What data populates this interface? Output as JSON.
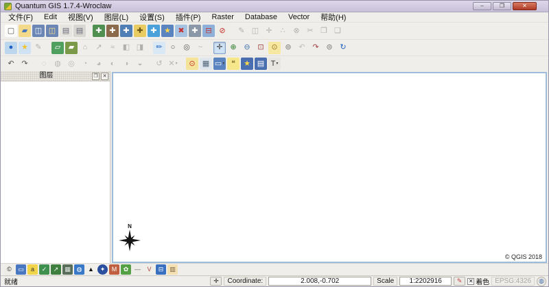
{
  "window": {
    "title": "Quantum GIS 1.7.4-Wroclaw",
    "buttons": [
      {
        "n": "minimize-button",
        "g": "–"
      },
      {
        "n": "restore-button",
        "g": "❐"
      },
      {
        "n": "close-button",
        "g": "✕",
        "cls": "close"
      }
    ]
  },
  "menu": {
    "items": [
      {
        "n": "menu-item-file",
        "g": "文件(F)"
      },
      {
        "n": "menu-item-edit",
        "g": "Edit"
      },
      {
        "n": "menu-item-view",
        "g": "视图(V)"
      },
      {
        "n": "menu-item-layer",
        "g": "图层(L)"
      },
      {
        "n": "menu-item-settings",
        "g": "设置(S)"
      },
      {
        "n": "menu-item-plugins",
        "g": "插件(P)"
      },
      {
        "n": "menu-item-raster",
        "g": "Raster"
      },
      {
        "n": "menu-item-database",
        "g": "Database"
      },
      {
        "n": "menu-item-vector",
        "g": "Vector"
      },
      {
        "n": "menu-item-help",
        "g": "帮助(H)"
      }
    ]
  },
  "toolbars": {
    "row1": [
      {
        "n": "new-project-icon",
        "g": "▢",
        "fg": "#555",
        "bg": "#fdfdfb"
      },
      {
        "n": "open-project-icon",
        "g": "▰",
        "fg": "#4a78b8",
        "bg": "#f3d98a"
      },
      {
        "n": "save-project-icon",
        "g": "◫",
        "fg": "#ffffff",
        "bg": "#6b86b5"
      },
      {
        "n": "save-project-as-icon",
        "g": "◫",
        "fg": "#ffe28a",
        "bg": "#6b86b5"
      },
      {
        "n": "new-print-composer-icon",
        "g": "▤",
        "fg": "#666677",
        "bg": "#e6e4de"
      },
      {
        "n": "composer-manager-icon",
        "g": "▤",
        "fg": "#666677",
        "bg": "#d9d7d1"
      },
      {
        "sep": true
      },
      {
        "n": "add-vector-layer-icon",
        "g": "✚",
        "fg": "#ffffff",
        "bg": "#4f8f4f"
      },
      {
        "n": "add-raster-layer-icon",
        "g": "✚",
        "fg": "#ffffff",
        "bg": "#8a6a4a"
      },
      {
        "n": "add-postgis-layer-icon",
        "g": "✚",
        "fg": "#ffffff",
        "bg": "#4f7fb5"
      },
      {
        "n": "add-spatialite-layer-icon",
        "g": "✚",
        "fg": "#6a5512",
        "bg": "#e8cc62"
      },
      {
        "n": "add-wms-layer-icon",
        "g": "✚",
        "fg": "#ffffff",
        "bg": "#4aa0d8"
      },
      {
        "n": "new-shapefile-layer-icon",
        "g": "★",
        "fg": "#ffd84a",
        "bg": "#5a84c0"
      },
      {
        "n": "remove-layer-icon",
        "g": "✖",
        "fg": "#c62f2f",
        "bg": "#a6c4e2"
      },
      {
        "n": "add-wfs-layer-icon",
        "g": "✚",
        "fg": "#ffffff",
        "bg": "#8a98a8"
      },
      {
        "n": "trash-layer-icon",
        "g": "⊟",
        "fg": "#c62f2f",
        "bg": "#8fb0d8"
      },
      {
        "n": "disable-edit-icon",
        "g": "⊘",
        "fg": "#c62828",
        "bg": "#efede7"
      },
      {
        "sep": true
      },
      {
        "n": "toggle-editing-icon",
        "g": "✎",
        "fg": "#555",
        "d": true
      },
      {
        "n": "save-edits-icon",
        "g": "◫",
        "fg": "#555",
        "d": true
      },
      {
        "n": "move-feature-icon",
        "g": "✛",
        "fg": "#555",
        "d": true
      },
      {
        "n": "node-tool-icon",
        "g": "∴",
        "fg": "#555",
        "d": true
      },
      {
        "n": "delete-selected-icon",
        "g": "⊗",
        "fg": "#555",
        "d": true
      },
      {
        "n": "cut-features-icon",
        "g": "✂",
        "fg": "#555",
        "d": true
      },
      {
        "n": "copy-features-icon",
        "g": "❐",
        "fg": "#555",
        "d": true
      },
      {
        "n": "paste-features-icon",
        "g": "❑",
        "fg": "#555",
        "d": true
      }
    ],
    "row2": [
      {
        "n": "capture-point-icon",
        "g": "●",
        "fg": "#2060c0",
        "bg": "#bcd6ee"
      },
      {
        "n": "star-annotation-icon",
        "g": "★",
        "fg": "#f2c230",
        "bg": "#cfe2f3"
      },
      {
        "n": "gray-annotation-icon",
        "g": "✎",
        "fg": "#555",
        "d": true
      },
      {
        "sep": true
      },
      {
        "n": "capture-line-icon",
        "g": "▱",
        "fg": "#ffffff",
        "bg": "#4f9f5f"
      },
      {
        "n": "capture-polygon-icon",
        "g": "▰",
        "fg": "#ffffff",
        "bg": "#7a9a4a"
      },
      {
        "n": "move-vertex-icon",
        "g": "⌂",
        "fg": "#555",
        "d": true
      },
      {
        "n": "rotate-feature-icon",
        "g": "↗",
        "fg": "#555",
        "d": true
      },
      {
        "n": "offset-curve-icon",
        "g": "≈",
        "fg": "#555",
        "d": true
      },
      {
        "n": "overview-panel-icon",
        "g": "◧",
        "fg": "#555",
        "d": true
      },
      {
        "n": "legend-panel-icon",
        "g": "◨",
        "fg": "#555",
        "d": true
      },
      {
        "sep": true
      },
      {
        "n": "measure-sketch-icon",
        "g": "✏",
        "fg": "#2060c0",
        "bg": "#d8e8f4"
      },
      {
        "n": "select-circle-icon",
        "g": "○",
        "fg": "#555"
      },
      {
        "n": "select-ellipse-icon",
        "g": "◎",
        "fg": "#555"
      },
      {
        "n": "select-freehand-icon",
        "g": "~",
        "fg": "#555",
        "d": true
      },
      {
        "sep": true
      },
      {
        "n": "pan-map-icon",
        "g": "✛",
        "fg": "#333",
        "bg": "#cfe2f6",
        "p": true
      },
      {
        "n": "zoom-in-icon",
        "g": "⊕",
        "fg": "#2e7d32"
      },
      {
        "n": "zoom-out-icon",
        "g": "⊖",
        "fg": "#3f6fae"
      },
      {
        "n": "zoom-full-icon",
        "g": "⊡",
        "fg": "#a04040"
      },
      {
        "n": "zoom-to-selection-icon",
        "g": "⊙",
        "fg": "#a07818",
        "bg": "#f6e8a0"
      },
      {
        "n": "zoom-to-layer-icon",
        "g": "⊚",
        "fg": "#777"
      },
      {
        "n": "zoom-last-icon",
        "g": "↶",
        "fg": "#777",
        "d": true
      },
      {
        "n": "zoom-next-icon",
        "g": "↷",
        "fg": "#a04040"
      },
      {
        "n": "zoom-actual-icon",
        "g": "⊜",
        "fg": "#777"
      },
      {
        "n": "refresh-map-icon",
        "g": "↻",
        "fg": "#2060c0"
      }
    ],
    "row3": [
      {
        "n": "undo-icon",
        "g": "↶",
        "fg": "#555"
      },
      {
        "n": "redo-icon",
        "g": "↷",
        "fg": "#555"
      },
      {
        "sep": true
      },
      {
        "n": "simplify-feature-icon",
        "g": "◌",
        "fg": "#666",
        "d": true
      },
      {
        "n": "add-ring-icon",
        "g": "◍",
        "fg": "#666",
        "d": true
      },
      {
        "n": "add-part-icon",
        "g": "◎",
        "fg": "#666",
        "d": true
      },
      {
        "n": "delete-ring-icon",
        "g": "◔",
        "fg": "#666",
        "d": true
      },
      {
        "n": "delete-part-icon",
        "g": "◕",
        "fg": "#666",
        "d": true
      },
      {
        "n": "reshape-features-icon",
        "g": "◐",
        "fg": "#666",
        "d": true
      },
      {
        "n": "split-features-icon",
        "g": "◑",
        "fg": "#666",
        "d": true
      },
      {
        "n": "merge-features-icon",
        "g": "◒",
        "fg": "#666",
        "d": true
      },
      {
        "sep": true
      },
      {
        "n": "rotate-point-symbols-icon",
        "g": "↺",
        "fg": "#666",
        "d": true
      },
      {
        "n": "deselect-all-icon",
        "g": "✕",
        "fg": "#666",
        "d": true,
        "dd": true
      },
      {
        "sep": true
      },
      {
        "n": "identify-features-icon",
        "g": "⊙",
        "fg": "#c62f2f",
        "bg": "#f4e49a"
      },
      {
        "n": "attribute-table-icon",
        "g": "▦",
        "fg": "#50657a",
        "bg": "#dfe6ee"
      },
      {
        "n": "measure-line-icon",
        "g": "▭",
        "fg": "#ffffff",
        "bg": "#5a84c0",
        "dd": true
      },
      {
        "n": "map-tips-icon",
        "g": "❝",
        "fg": "#8a7030",
        "bg": "#f6e88a"
      },
      {
        "n": "new-bookmark-icon",
        "g": "★",
        "fg": "#ffd84a",
        "bg": "#4a6fb0"
      },
      {
        "n": "show-bookmarks-icon",
        "g": "▤",
        "fg": "#ffffff",
        "bg": "#4a6fb0"
      },
      {
        "n": "text-annotation-icon",
        "g": "T",
        "fg": "#333",
        "bg": "#e8e6e0",
        "dd": true
      }
    ],
    "bottom": [
      {
        "n": "copyright-label-icon",
        "g": "©",
        "fg": "#333",
        "bg": "#efede7"
      },
      {
        "n": "scale-bar-icon",
        "g": "▭",
        "fg": "#ffffff",
        "bg": "#4a78c0"
      },
      {
        "n": "labeling-icon",
        "g": "a",
        "fg": "#333",
        "bg": "#f2d44a"
      },
      {
        "n": "ftools-icon",
        "g": "✓",
        "fg": "#ffffff",
        "bg": "#3f8f4f"
      },
      {
        "n": "export-layer-icon",
        "g": "↗",
        "fg": "#ffffff",
        "bg": "#3f7f3f"
      },
      {
        "n": "raster-calculator-icon",
        "g": "▦",
        "fg": "#dfe4df",
        "bg": "#5a6f5a"
      },
      {
        "n": "globe-icon",
        "g": "◍",
        "fg": "#ffffff",
        "bg": "#3a78c8"
      },
      {
        "n": "profile-tool-icon",
        "g": "▲",
        "fg": "#111",
        "bg": "#f2f0ea"
      },
      {
        "n": "north-arrow-plugin-icon",
        "g": "✦",
        "fg": "#ffffff",
        "bg": "#2a4f9f",
        "cls": "round"
      },
      {
        "n": "mapserver-export-icon",
        "g": "M",
        "fg": "#ffffff",
        "bg": "#c06040"
      },
      {
        "n": "leaf-plugin-icon",
        "g": "✿",
        "fg": "#ffffff",
        "bg": "#55a045"
      },
      {
        "n": "dxf2shp-icon",
        "g": "—",
        "fg": "#666",
        "bg": "#efede7"
      },
      {
        "n": "interpolation-icon",
        "g": "V",
        "fg": "#b04040",
        "bg": "#f0eee8"
      },
      {
        "n": "road-graph-icon",
        "g": "⊟",
        "fg": "#ffffff",
        "bg": "#3a70c0"
      },
      {
        "n": "georeferencer-icon",
        "g": "▥",
        "fg": "#7a6045",
        "bg": "#f4e0b0"
      }
    ]
  },
  "layers_panel": {
    "title": "图层",
    "float_glyph": "❐",
    "close_glyph": "✕"
  },
  "canvas": {
    "north_label": "N",
    "copyright": "© QGIS 2018"
  },
  "statusbar": {
    "ready": "就绪",
    "extents_glyph": "✛",
    "coordinate_label": "Coordinate:",
    "coordinate_value": "2.008,-0.702",
    "scale_label": "Scale",
    "scale_value": "1:2202916",
    "brush_glyph": "✎",
    "render_checked_glyph": "✕",
    "render_label": "着色",
    "epsg": "EPSG:4326",
    "crs_glyph": "◍"
  },
  "colors": {
    "titlebar": "#cfc6de",
    "toolbar_bg": "#f0eeea",
    "canvas_border": "#9dbcdc",
    "close_button": "#ad3a26",
    "pressed_tool_bg": "#cfe2f6",
    "epsg_text": "#aaa79f"
  }
}
